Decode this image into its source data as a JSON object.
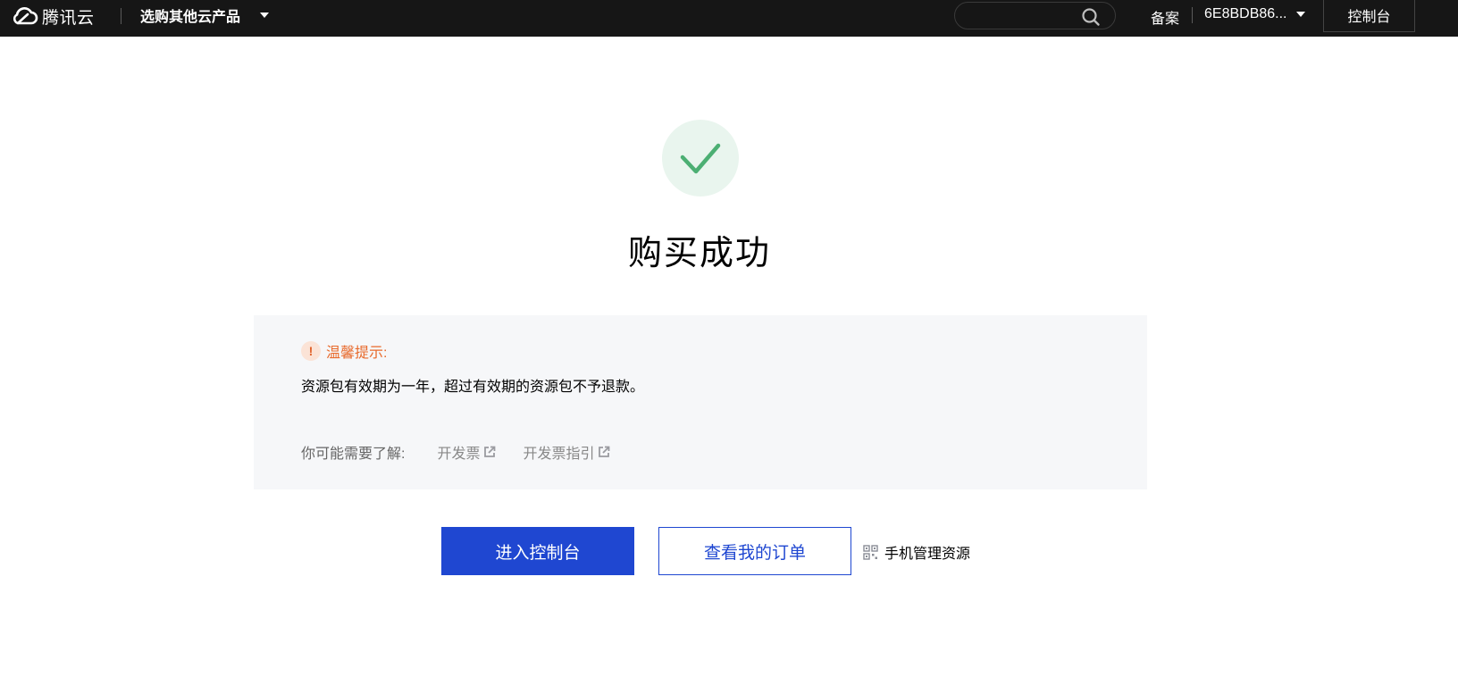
{
  "topbar": {
    "brand": "腾讯云",
    "product_menu": "选购其他云产品",
    "search": {
      "value": "",
      "placeholder": ""
    },
    "beian": "备案",
    "account": "6E8BDB86...",
    "console": "控制台"
  },
  "result": {
    "title": "购买成功",
    "status": "success"
  },
  "tip": {
    "title": "温馨提示:",
    "body": "资源包有效期为一年，超过有效期的资源包不予退款。",
    "links_label": "你可能需要了解:",
    "links": [
      {
        "label": "开发票"
      },
      {
        "label": "开发票指引"
      }
    ]
  },
  "actions": {
    "primary": "进入控制台",
    "secondary": "查看我的订单",
    "mobile": "手机管理资源"
  },
  "colors": {
    "topbar_bg": "#161616",
    "primary": "#1f47d1",
    "success": "#4caf73",
    "warning": "#e86a2c",
    "panel_bg": "#f6f7f9"
  },
  "icons": {
    "logo": "cloud-logo-icon",
    "search": "search-icon",
    "success": "checkmark-icon",
    "warning": "exclamation-icon",
    "external": "external-link-icon",
    "qr": "qr-code-icon"
  }
}
